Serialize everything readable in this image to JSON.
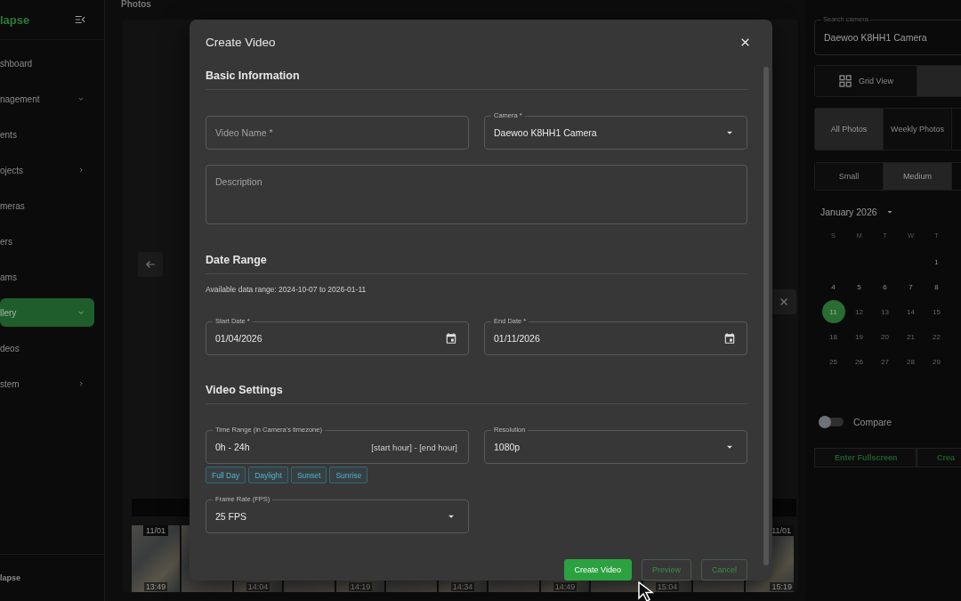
{
  "sidebar": {
    "logo": "lapse",
    "items": [
      {
        "kind": "link",
        "label": "shboard",
        "selected": false
      },
      {
        "kind": "group",
        "label": "nagement",
        "expanded": true,
        "selected": false
      },
      {
        "kind": "link",
        "label": "ents",
        "selected": false
      },
      {
        "kind": "group",
        "label": "ojects",
        "expanded": false,
        "selected": false
      },
      {
        "kind": "link",
        "label": "meras",
        "selected": false
      },
      {
        "kind": "link",
        "label": "ers",
        "selected": false
      },
      {
        "kind": "link",
        "label": "ams",
        "selected": false
      },
      {
        "kind": "group",
        "label": "llery",
        "expanded": true,
        "selected": true
      },
      {
        "kind": "link",
        "label": "deos",
        "selected": false
      },
      {
        "kind": "group",
        "label": "stem",
        "expanded": false,
        "selected": false
      }
    ],
    "footer": "lapse"
  },
  "main": {
    "title": "Photos",
    "thumbnails": [
      {
        "date": "11/01",
        "time": "13:49"
      },
      {
        "time": "14:04"
      },
      {
        "time": "14:19"
      },
      {
        "time": "14:34"
      },
      {
        "time": "14:49"
      },
      {
        "time": "15:04"
      },
      {
        "date": "11/01",
        "time": "15:19"
      }
    ]
  },
  "right_panel": {
    "search": {
      "label": "Search camera",
      "value": "Daewoo K8HH1 Camera"
    },
    "view_toggle": [
      {
        "kind": "grid",
        "label": "Grid View",
        "selected": false
      },
      {
        "kind": "rows",
        "selected": true
      }
    ],
    "photo_filter": [
      {
        "label": "All Photos",
        "selected": true
      },
      {
        "label": "Weekly Photos",
        "selected": false
      }
    ],
    "sizes": [
      {
        "label": "Small",
        "selected": false
      },
      {
        "label": "Medium",
        "selected": true
      }
    ],
    "calendar": {
      "month": "January 2026",
      "weekdays": [
        "S",
        "M",
        "T",
        "W",
        "T"
      ],
      "weeks": [
        [
          {
            "day": "1",
            "selected": false,
            "disabled": false
          }
        ],
        [
          {
            "day": "4",
            "selected": false,
            "disabled": false
          },
          {
            "day": "5",
            "selected": false,
            "disabled": false
          },
          {
            "day": "6",
            "selected": false,
            "disabled": false
          },
          {
            "day": "7",
            "selected": false,
            "disabled": false
          },
          {
            "day": "8",
            "selected": false,
            "disabled": false
          }
        ],
        [
          {
            "day": "11",
            "selected": true,
            "disabled": false
          },
          {
            "day": "12",
            "selected": false,
            "disabled": true
          },
          {
            "day": "13",
            "selected": false,
            "disabled": true
          },
          {
            "day": "14",
            "selected": false,
            "disabled": true
          },
          {
            "day": "15",
            "selected": false,
            "disabled": true
          }
        ],
        [
          {
            "day": "18",
            "selected": false,
            "disabled": true
          },
          {
            "day": "19",
            "selected": false,
            "disabled": true
          },
          {
            "day": "20",
            "selected": false,
            "disabled": true
          },
          {
            "day": "21",
            "selected": false,
            "disabled": true
          },
          {
            "day": "22",
            "selected": false,
            "disabled": true
          }
        ],
        [
          {
            "day": "25",
            "selected": false,
            "disabled": true
          },
          {
            "day": "26",
            "selected": false,
            "disabled": true
          },
          {
            "day": "27",
            "selected": false,
            "disabled": true
          },
          {
            "day": "28",
            "selected": false,
            "disabled": true
          },
          {
            "day": "29",
            "selected": false,
            "disabled": true
          }
        ]
      ]
    },
    "compare": {
      "label": "Compare",
      "on": false
    },
    "actions": [
      "Enter Fullscreen",
      "Crea"
    ]
  },
  "dialog": {
    "title": "Create Video",
    "basic": {
      "heading": "Basic Information",
      "video_name": {
        "placeholder": "Video Name *"
      },
      "camera": {
        "label": "Camera *",
        "value": "Daewoo K8HH1 Camera"
      },
      "description": {
        "placeholder": "Description"
      }
    },
    "date_range": {
      "heading": "Date Range",
      "note": "Available data range: 2024-10-07 to 2026-01-11",
      "start": {
        "label": "Start Date *",
        "value": "01/04/2026"
      },
      "end": {
        "label": "End Date *",
        "value": "01/11/2026"
      }
    },
    "video_settings": {
      "heading": "Video Settings",
      "time_range": {
        "label": "Time Range (in Camera's timezone)",
        "value": "0h - 24h",
        "hint": "[start hour] - [end hour]"
      },
      "presets": [
        "Full Day",
        "Daylight",
        "Sunset",
        "Sunrise"
      ],
      "resolution": {
        "label": "Resolution",
        "value": "1080p"
      },
      "frame_rate": {
        "label": "Frame Rate (FPS)",
        "value": "25 FPS"
      }
    },
    "buttons": [
      {
        "label": "Create Video",
        "kind": "primary"
      },
      {
        "label": "Preview",
        "kind": "outlined"
      },
      {
        "label": "Cancel",
        "kind": "outlined"
      }
    ]
  }
}
